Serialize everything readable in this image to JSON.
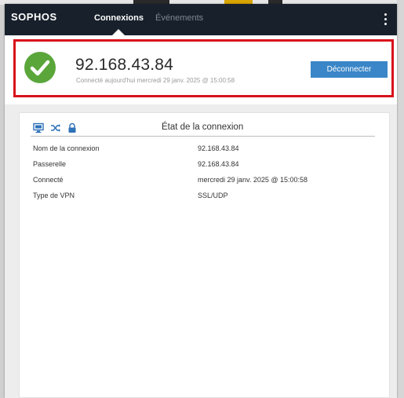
{
  "header": {
    "logo": "SOPHOS",
    "tabs": [
      {
        "label": "Connexions",
        "active": true
      },
      {
        "label": "Événements",
        "active": false
      }
    ],
    "menu_icon": "vertical-ellipsis-icon"
  },
  "connection": {
    "status_icon": "check-circle-icon",
    "status_color": "#5aa63a",
    "title": "92.168.43.84",
    "subtitle": "Connecté aujourd'hui mercredi 29 janv. 2025 @ 15:00:58",
    "disconnect_label": "Déconnecter"
  },
  "details": {
    "icons": [
      "monitor-icon",
      "shuffle-icon",
      "lock-icon"
    ],
    "title": "État de la connexion",
    "rows": [
      {
        "label": "Nom de la connexion",
        "value": "92.168.43.84"
      },
      {
        "label": "Passerelle",
        "value": "92.168.43.84"
      },
      {
        "label": "Connecté",
        "value": "mercredi 29 janv. 2025 @ 15:00:58"
      },
      {
        "label": "Type de VPN",
        "value": "SSL/UDP"
      }
    ]
  },
  "colors": {
    "header_bg": "#17202b",
    "accent": "#3a86c8",
    "highlight": "#d8121b"
  }
}
